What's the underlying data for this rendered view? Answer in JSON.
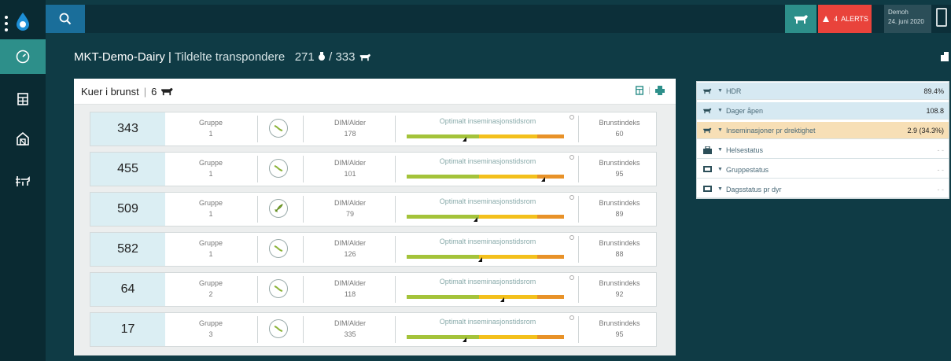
{
  "header": {
    "alerts_count": "4",
    "alerts_label": "ALERTS",
    "user_name": "Demoh",
    "date": "24. juni 2020"
  },
  "page": {
    "farm_name": "MKT-Demo-Dairy",
    "separator": "|",
    "subtitle": "Tildelte transpondere",
    "assigned_count": "271",
    "slash": "/",
    "total_count": "333"
  },
  "heat_card": {
    "title": "Kuer i brunst",
    "separator": "|",
    "count": "6",
    "group_label": "Gruppe",
    "dim_label": "DIM/Alder",
    "bar_label": "Optimalt inseminasjonstidsrom",
    "index_label": "Brunstindeks",
    "rows": [
      {
        "id": "343",
        "group": "1",
        "dim": "178",
        "index": "60",
        "icon": "activity-curve-icon",
        "marker_pos": 0.38
      },
      {
        "id": "455",
        "group": "1",
        "dim": "101",
        "index": "95",
        "icon": "activity-curve-icon",
        "marker_pos": 0.88
      },
      {
        "id": "509",
        "group": "1",
        "dim": "79",
        "index": "89",
        "icon": "rocket-icon",
        "marker_pos": 0.45
      },
      {
        "id": "582",
        "group": "1",
        "dim": "126",
        "index": "88",
        "icon": "activity-curve-icon",
        "marker_pos": 0.48
      },
      {
        "id": "64",
        "group": "2",
        "dim": "118",
        "index": "92",
        "icon": "activity-curve-icon",
        "marker_pos": 0.62
      },
      {
        "id": "17",
        "group": "3",
        "dim": "335",
        "index": "95",
        "icon": "activity-curve-icon",
        "marker_pos": 0.38
      }
    ]
  },
  "kpi_panel": {
    "rows": [
      {
        "label": "HDR",
        "value": "89.4%",
        "icon": "cow-icon",
        "style": "blue"
      },
      {
        "label": "Dager åpen",
        "value": "108.8",
        "icon": "cow-icon",
        "style": "blue"
      },
      {
        "label": "Inseminasjoner pr drektighet",
        "value": "2.9 (34.3%)",
        "icon": "cow-icon",
        "style": "peach"
      },
      {
        "label": "Helsestatus",
        "value": "- -",
        "icon": "briefcase-icon",
        "style": "white"
      },
      {
        "label": "Gruppestatus",
        "value": "- -",
        "icon": "monitor-icon",
        "style": "white"
      },
      {
        "label": "Dagsstatus pr dyr",
        "value": "- -",
        "icon": "monitor-icon",
        "style": "white"
      }
    ]
  },
  "colors": {
    "accent_teal": "#2d8f8a",
    "alert_red": "#e9433b",
    "bar_green": "#a4c33a",
    "bar_yellow": "#f3c01c",
    "bar_orange": "#e89228"
  }
}
